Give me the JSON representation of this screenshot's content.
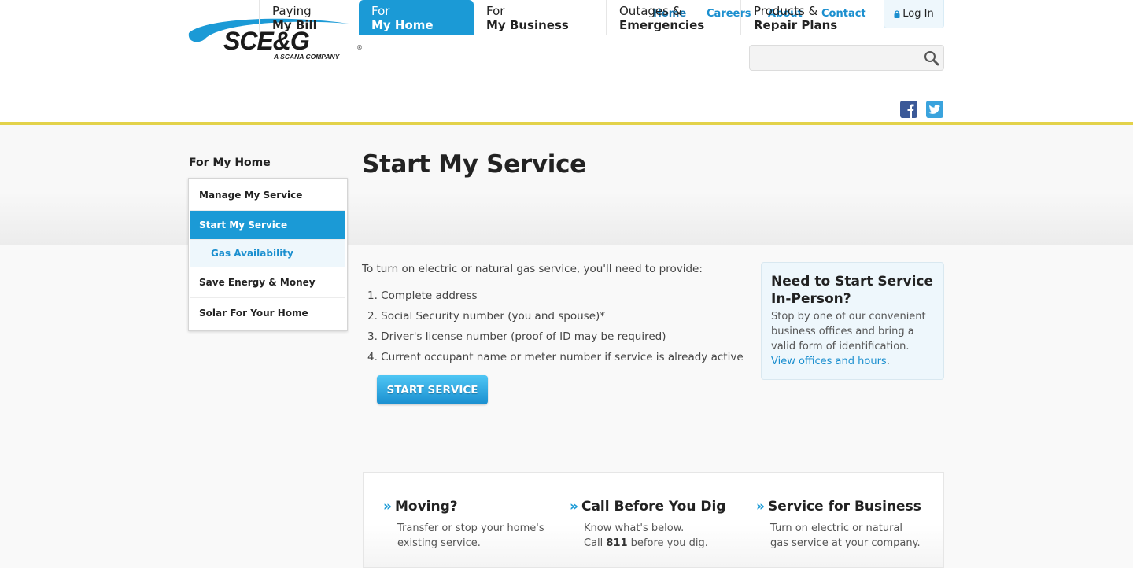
{
  "brand": {
    "name": "SCE&G",
    "registered_mark": "®",
    "tagline": "A SCANA COMPANY",
    "accent_color": "#1b9ad6",
    "bar_color": "#e3d24a"
  },
  "utility_nav": {
    "links": [
      "Home",
      "Careers",
      "About",
      "Contact"
    ],
    "login_label": "Log In"
  },
  "search": {
    "value": "",
    "placeholder": ""
  },
  "main_nav": [
    {
      "line1": "Paying",
      "line2": "My Bill",
      "active": false
    },
    {
      "line1": "For",
      "line2": "My Home",
      "active": true
    },
    {
      "line1": "For",
      "line2": "My Business",
      "active": false
    },
    {
      "line1": "Outages &",
      "line2": "Emergencies",
      "active": false
    },
    {
      "line1": "Products &",
      "line2": "Repair Plans",
      "active": false
    }
  ],
  "social": [
    "facebook-icon",
    "twitter-icon"
  ],
  "sidebar": {
    "title": "For My Home",
    "items": [
      {
        "label": "Manage My Service",
        "state": "normal"
      },
      {
        "label": "Start My Service",
        "state": "active"
      },
      {
        "label": "Gas Availability",
        "state": "sub"
      },
      {
        "label": "Save Energy & Money",
        "state": "normal"
      },
      {
        "label": "Solar For Your Home",
        "state": "normal"
      }
    ]
  },
  "page": {
    "title": "Start My Service",
    "intro": "To turn on electric or natural gas service, you'll need to provide:",
    "requirements": [
      "1. Complete address",
      "2. Social Security number (you and spouse)*",
      "3. Driver's license number (proof of ID may be required)",
      "4. Current occupant name or meter number if service is already active"
    ],
    "start_button": "START SERVICE"
  },
  "callout": {
    "title": "Need to Start Service In-Person?",
    "body": "Stop by one of our convenient business offices and bring a valid form of identification.",
    "link": "View offices and hours",
    "link_suffix": "."
  },
  "tiles": [
    {
      "title": "Moving?",
      "line1": "Transfer or stop your home's",
      "line2": "existing service."
    },
    {
      "title": "Call Before You Dig",
      "line1": "Know what's below.",
      "line2_pre": "Call ",
      "line2_bold": "811",
      "line2_post": " before you dig."
    },
    {
      "title": "Service for Business",
      "line1": "Turn on electric or natural",
      "line2": "gas service at your company."
    }
  ]
}
